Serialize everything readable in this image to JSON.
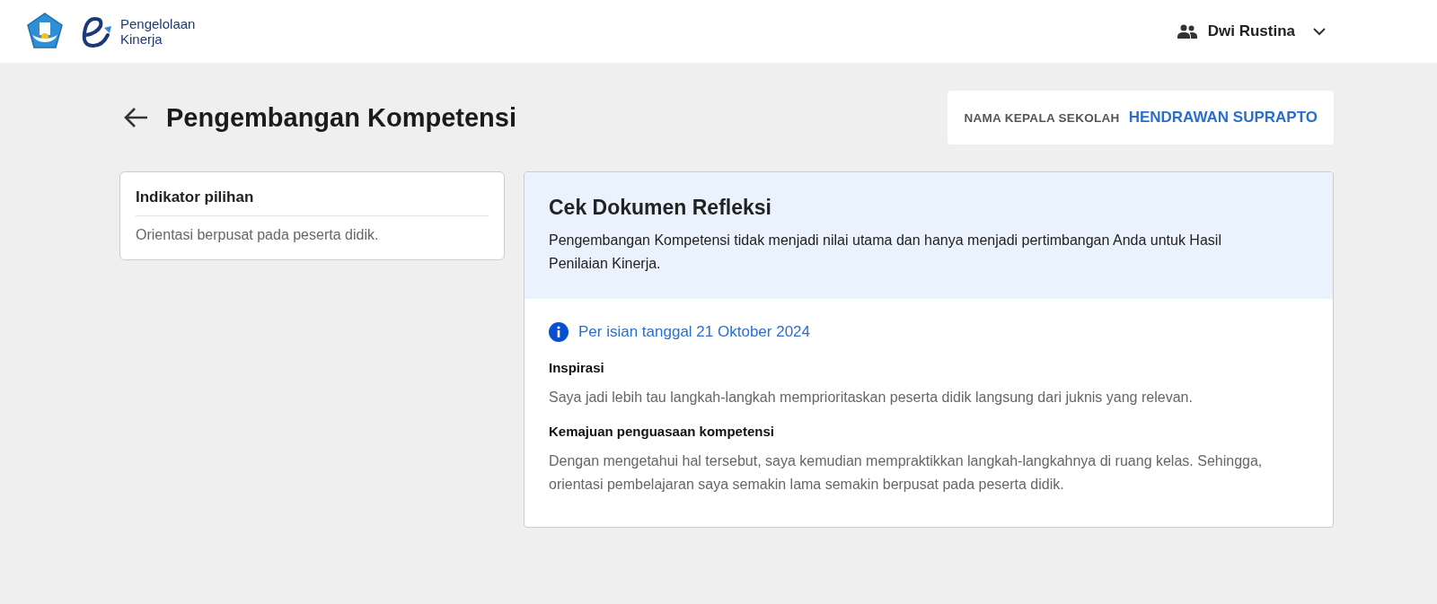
{
  "header": {
    "app_name_line1": "Pengelolaan",
    "app_name_line2": "Kinerja",
    "user_name": "Dwi Rustina"
  },
  "page": {
    "title": "Pengembangan Kompetensi",
    "principal_label": "NAMA KEPALA SEKOLAH",
    "principal_name": "HENDRAWAN SUPRAPTO"
  },
  "indicator_card": {
    "title": "Indikator pilihan",
    "text": "Orientasi berpusat pada peserta didik."
  },
  "reflection": {
    "title": "Cek Dokumen Refleksi",
    "description": "Pengembangan Kompetensi tidak menjadi nilai utama dan hanya menjadi pertimbangan Anda untuk Hasil Penilaian Kinerja.",
    "date_note": "Per isian tanggal 21 Oktober 2024",
    "sections": [
      {
        "heading": "Inspirasi",
        "text": "Saya jadi lebih tau langkah-langkah memprioritaskan peserta didik langsung dari juknis yang relevan."
      },
      {
        "heading": "Kemajuan penguasaan kompetensi",
        "text": "Dengan mengetahui hal tersebut, saya kemudian mempraktikkan langkah-langkahnya di ruang kelas. Sehingga, orientasi pembelajaran saya semakin lama semakin berpusat pada peserta didik."
      }
    ]
  }
}
